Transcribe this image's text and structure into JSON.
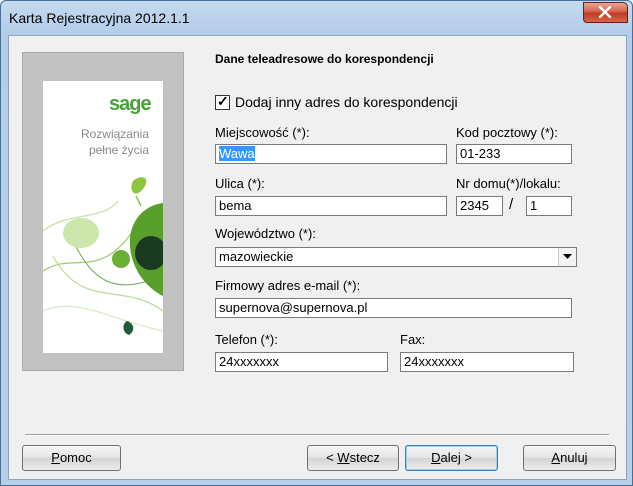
{
  "window": {
    "title": "Karta Rejestracyjna 2012.1.1",
    "close_icon": "close-icon"
  },
  "brand": {
    "logo": "sage",
    "tagline_line1": "Rozwiązania",
    "tagline_line2": "pełne życia",
    "colors": {
      "green": "#4aa13a",
      "dark_green": "#1d3b22",
      "light_green": "#c8e3a4"
    }
  },
  "form": {
    "heading": "Dane teleadresowe do korespondencji",
    "checkbox_label": "Dodaj inny adres do korespondencji",
    "checkbox_checked": true,
    "city": {
      "label": "Miejscowość (*):",
      "value": "Wawa"
    },
    "postal": {
      "label": "Kod pocztowy (*):",
      "value": "01-233"
    },
    "street": {
      "label": "Ulica (*):",
      "value": "bema"
    },
    "house": {
      "label": "Nr domu(*)/lokalu:",
      "number": "2345",
      "separator": "/",
      "flat": "1"
    },
    "voivodeship": {
      "label": "Województwo (*):",
      "value": "mazowieckie"
    },
    "email": {
      "label": "Firmowy adres e-mail (*):",
      "value": "supernova@supernova.pl"
    },
    "phone": {
      "label": "Telefon (*):",
      "value": "24xxxxxxx"
    },
    "fax": {
      "label": "Fax:",
      "value": "24xxxxxxx"
    }
  },
  "buttons": {
    "help": {
      "mnemonic": "P",
      "rest": "omoc"
    },
    "back": {
      "prefix": "< ",
      "mnemonic": "W",
      "rest": "stecz"
    },
    "next": {
      "mnemonic": "D",
      "rest": "alej >"
    },
    "cancel": {
      "mnemonic": "A",
      "rest": "nuluj"
    }
  }
}
